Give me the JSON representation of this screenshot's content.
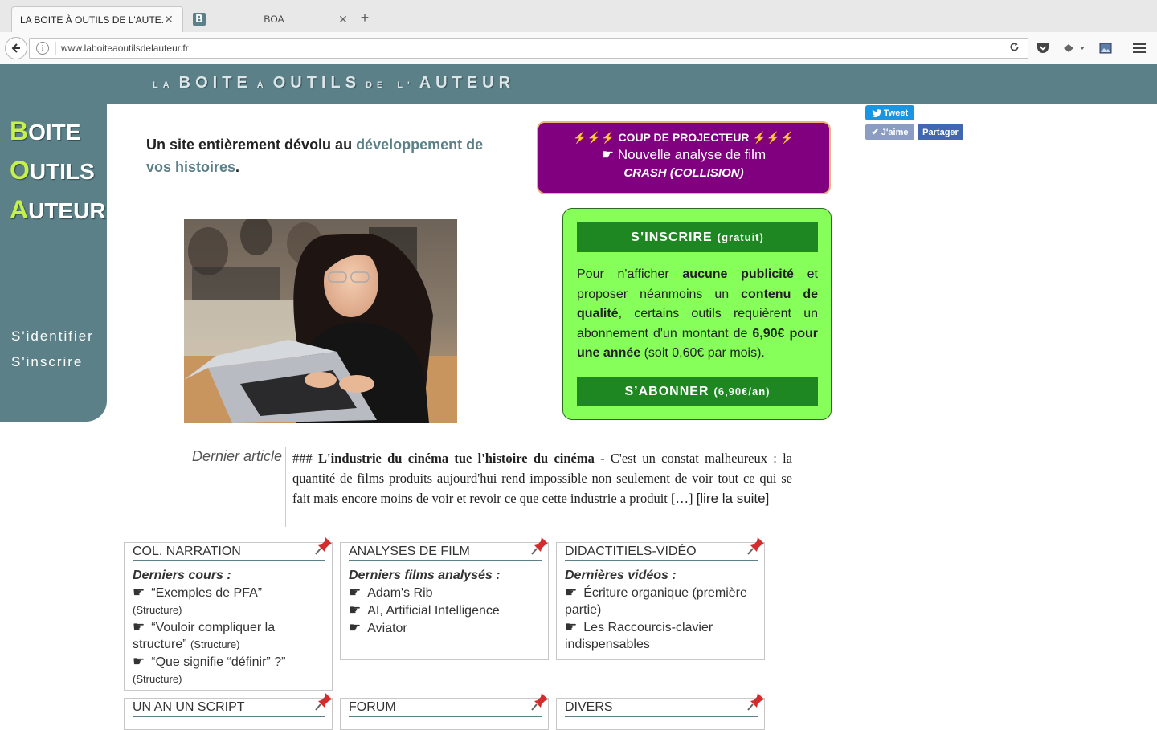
{
  "browser": {
    "tabs": [
      {
        "title": "LA BOITE À OUTILS DE L'AUTE...",
        "close": "✕"
      },
      {
        "title": "BOA",
        "favicon": "B",
        "close": "✕"
      }
    ],
    "new_tab": "+",
    "url": "www.laboiteaoutilsdelauteur.fr"
  },
  "header": {
    "title": [
      {
        "text": "LA",
        "size": "small"
      },
      {
        "text": "BOITE",
        "size": "big"
      },
      {
        "text": "À",
        "size": "small"
      },
      {
        "text": "OUTILS",
        "size": "big"
      },
      {
        "text": "DE",
        "size": "small"
      },
      {
        "text": "L'",
        "size": "small"
      },
      {
        "text": "AUTEUR",
        "size": "big"
      }
    ]
  },
  "sidebar": {
    "logo": [
      {
        "initial": "B",
        "rest": "OITE"
      },
      {
        "initial": "O",
        "rest": "UTILS"
      },
      {
        "initial": "A",
        "rest": "UTEUR"
      }
    ],
    "login": "S'identifier",
    "register": "S'inscrire"
  },
  "intro": {
    "text": "Un site entièrement dévolu au ",
    "highlight": "développement de vos histoires",
    "end": "."
  },
  "promo": {
    "bolts": "⚡⚡⚡",
    "heading": "COUP DE PROJECTEUR",
    "finger": "☛",
    "line": "Nouvelle analyse de film",
    "film": "CRASH (COLLISION)"
  },
  "subscribe": {
    "register_label": "S’INSCRIRE",
    "register_note": "(gratuit)",
    "text_parts": [
      {
        "t": "Pour n'afficher ",
        "b": false
      },
      {
        "t": "aucune publicité",
        "b": true
      },
      {
        "t": " et proposer néanmoins un ",
        "b": false
      },
      {
        "t": "contenu de qualité",
        "b": true
      },
      {
        "t": ", certains outils requièrent un abonnement d'un montant de ",
        "b": false
      },
      {
        "t": "6,90€ pour une année",
        "b": true
      },
      {
        "t": " (soit 0,60€ par mois).",
        "b": false
      }
    ],
    "subscribe_label": "S’ABONNER",
    "subscribe_note": "(6,90€/an)"
  },
  "social": {
    "tweet": "Tweet",
    "like": "J'aime",
    "share": "Partager"
  },
  "last_article": {
    "label": "Dernier article",
    "prefix": "### ",
    "title": "L'industrie du cinéma tue l'histoire du cinéma",
    "excerpt": " - C'est un constat malheureux : la quantité de films produits aujourd'hui rend impossible non seulement de voir tout ce qui se fait mais encore moins de voir et revoir ce que cette industrie a produit […] ",
    "more": "[lire la suite]"
  },
  "panels": [
    {
      "title": "COL. NARRATION",
      "subtitle": "Derniers cours :",
      "items": [
        {
          "text": "“Exemples de PFA”",
          "cat": "(Structure)"
        },
        {
          "text": "“Vouloir compliquer la structure”",
          "cat": "(Structure)"
        },
        {
          "text": "“Que signifie “définir” ?”",
          "cat": "(Structure)"
        }
      ]
    },
    {
      "title": "ANALYSES DE FILM",
      "subtitle": "Derniers films analysés :",
      "items": [
        {
          "text": "Adam's Rib",
          "cat": ""
        },
        {
          "text": "AI, Artificial Intelligence",
          "cat": ""
        },
        {
          "text": "Aviator",
          "cat": ""
        }
      ]
    },
    {
      "title": "DIDACTITIELS-VIDÉO",
      "subtitle": "Dernières vidéos :",
      "items": [
        {
          "text": "Écriture organique (première partie)",
          "cat": ""
        },
        {
          "text": "Les Raccourcis-clavier indispensables",
          "cat": ""
        }
      ]
    },
    {
      "title": "UN AN UN SCRIPT"
    },
    {
      "title": "FORUM"
    },
    {
      "title": "DIVERS"
    }
  ],
  "colors": {
    "brand": "#5b8088",
    "logo_initial": "#c6f04a",
    "promo_bg": "#800080",
    "subscribe_bg": "#87ff5a",
    "button_green": "#1e8722"
  }
}
